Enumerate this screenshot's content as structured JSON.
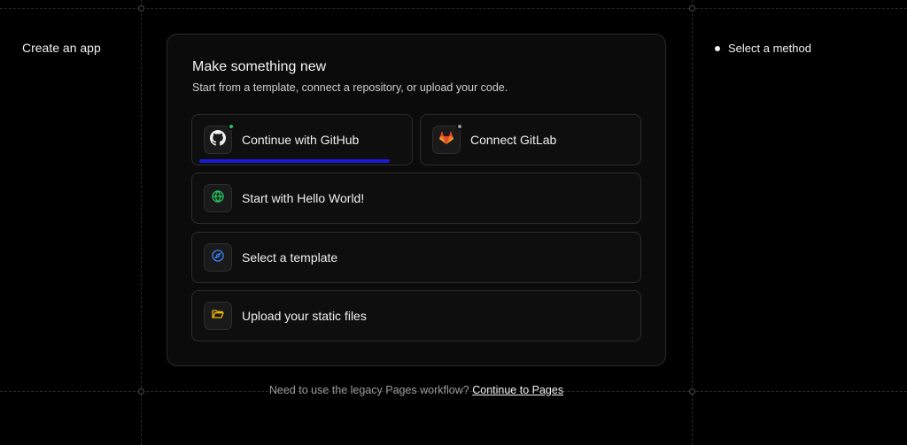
{
  "sidebar": {
    "title": "Create an app"
  },
  "steps": {
    "current": "Select a method"
  },
  "card": {
    "title": "Make something new",
    "subtitle": "Start from a template, connect a repository, or upload your code."
  },
  "options": {
    "github": {
      "label": "Continue with GitHub",
      "icon": "github-icon",
      "status_color": "#22c55e"
    },
    "gitlab": {
      "label": "Connect GitLab",
      "icon": "gitlab-icon",
      "status_color": "#9a9a9a"
    },
    "hello_world": {
      "label": "Start with Hello World!",
      "icon": "globe-icon",
      "icon_color": "#22c55e"
    },
    "template": {
      "label": "Select a template",
      "icon": "compass-icon",
      "icon_color": "#3b82f6"
    },
    "upload": {
      "label": "Upload your static files",
      "icon": "folder-icon",
      "icon_color": "#eab308"
    }
  },
  "footer": {
    "text": "Need to use the legacy Pages workflow?",
    "link": "Continue to Pages"
  },
  "colors": {
    "accent": "#1a1ad9",
    "background": "#000000",
    "card": "#0b0b0b",
    "gitlab_orange": "#e24329"
  }
}
